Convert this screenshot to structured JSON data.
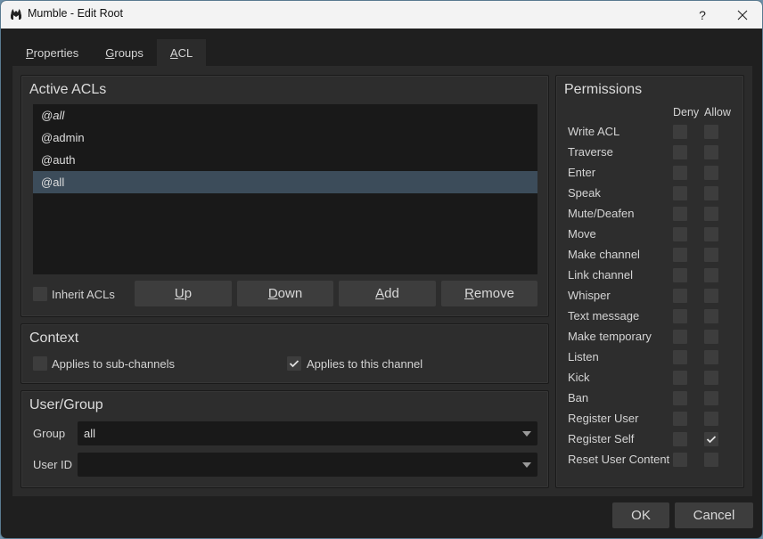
{
  "window": {
    "title": "Mumble - Edit Root",
    "help_label": "?",
    "close_label": "✕"
  },
  "tabs": [
    {
      "label": "Properties",
      "mnemonic": "P",
      "rest": "roperties",
      "active": false
    },
    {
      "label": "Groups",
      "mnemonic": "G",
      "rest": "roups",
      "active": false
    },
    {
      "label": "ACL",
      "mnemonic": "A",
      "rest": "CL",
      "active": true
    }
  ],
  "active_acls": {
    "title": "Active ACLs",
    "items": [
      {
        "label": "@all",
        "italic": true,
        "selected": false
      },
      {
        "label": "@admin",
        "italic": false,
        "selected": false
      },
      {
        "label": "@auth",
        "italic": false,
        "selected": false
      },
      {
        "label": "@all",
        "italic": false,
        "selected": true
      }
    ],
    "inherit_label": "Inherit ACLs",
    "inherit_checked": false,
    "buttons": {
      "up": {
        "mnemonic": "U",
        "rest": "p"
      },
      "down": {
        "mnemonic": "D",
        "rest": "own"
      },
      "add": {
        "mnemonic": "A",
        "rest": "dd"
      },
      "remove": {
        "mnemonic": "R",
        "rest": "emove"
      }
    }
  },
  "context": {
    "title": "Context",
    "sub_channels_label": "Applies to sub-channels",
    "sub_channels_checked": false,
    "this_channel_label": "Applies to this channel",
    "this_channel_checked": true
  },
  "user_group": {
    "title": "User/Group",
    "group_label": "Group",
    "group_value": "all",
    "user_id_label": "User ID",
    "user_id_value": ""
  },
  "permissions": {
    "title": "Permissions",
    "deny_header": "Deny",
    "allow_header": "Allow",
    "rows": [
      {
        "label": "Write ACL",
        "deny": false,
        "allow": false
      },
      {
        "label": "Traverse",
        "deny": false,
        "allow": false
      },
      {
        "label": "Enter",
        "deny": false,
        "allow": false
      },
      {
        "label": "Speak",
        "deny": false,
        "allow": false
      },
      {
        "label": "Mute/Deafen",
        "deny": false,
        "allow": false
      },
      {
        "label": "Move",
        "deny": false,
        "allow": false
      },
      {
        "label": "Make channel",
        "deny": false,
        "allow": false
      },
      {
        "label": "Link channel",
        "deny": false,
        "allow": false
      },
      {
        "label": "Whisper",
        "deny": false,
        "allow": false
      },
      {
        "label": "Text message",
        "deny": false,
        "allow": false
      },
      {
        "label": "Make temporary",
        "deny": false,
        "allow": false
      },
      {
        "label": "Listen",
        "deny": false,
        "allow": false
      },
      {
        "label": "Kick",
        "deny": false,
        "allow": false
      },
      {
        "label": "Ban",
        "deny": false,
        "allow": false
      },
      {
        "label": "Register User",
        "deny": false,
        "allow": false
      },
      {
        "label": "Register Self",
        "deny": false,
        "allow": true
      },
      {
        "label": "Reset User Content",
        "deny": false,
        "allow": false
      }
    ]
  },
  "footer": {
    "ok_label": "OK",
    "cancel_label": "Cancel"
  }
}
